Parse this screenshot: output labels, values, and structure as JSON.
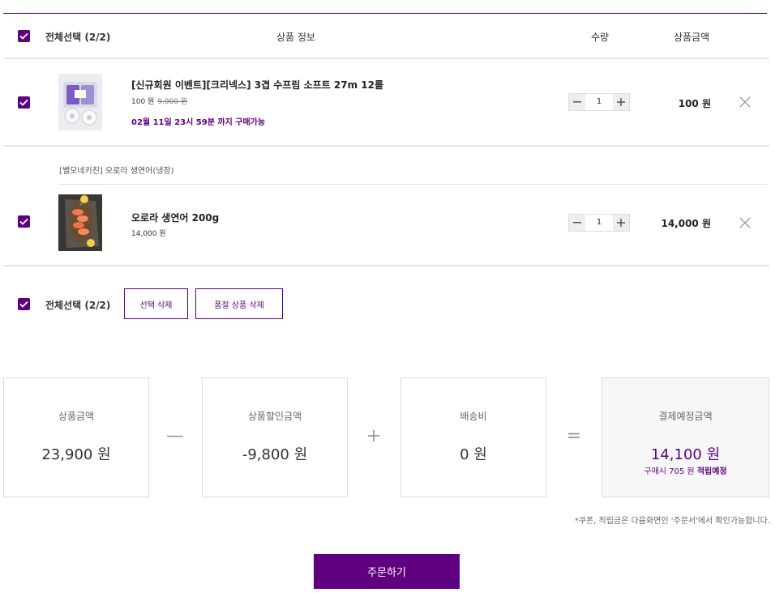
{
  "header": {
    "select_all_label": "전체선택 (2/2)",
    "product_info_label": "상품 정보",
    "quantity_label": "수량",
    "price_label": "상품금액"
  },
  "items": [
    {
      "name": "[신규회원 이벤트][크리넥스] 3겹 수프림 소프트 27m 12롤",
      "price": "100 원",
      "original_price": "9,900 원",
      "deadline": "02월 11일 23시 59분 까지 구매가능",
      "quantity": "1",
      "total": "100 원",
      "checked": true,
      "thumb_icon": "toilet-paper-pack"
    },
    {
      "vendor": "[쌜모네키친] 오로라 생연어(냉장)",
      "name": "오로라 생연어 200g",
      "price": "14,000 원",
      "quantity": "1",
      "total": "14,000 원",
      "checked": true,
      "thumb_icon": "salmon-platter"
    }
  ],
  "footer_select": {
    "select_all_label": "전체선택 (2/2)",
    "delete_selected": "선택 삭제",
    "delete_soldout": "품절 상품 삭제"
  },
  "summary": {
    "product_amount_label": "상품금액",
    "product_amount": "23,900 원",
    "discount_label": "상품할인금액",
    "discount": "-9,800 원",
    "shipping_label": "배송비",
    "shipping": "0 원",
    "total_label": "결제예정금액",
    "total": "14,100 원",
    "points_prefix": "구매시 705 원",
    "points_suffix": "적립예정",
    "op_minus": "—",
    "op_plus": "+",
    "op_equals": "="
  },
  "notice": "*쿠폰, 적립금은 다음화면인 '주문서'에서 확인가능합니다.",
  "order_button": "주문하기",
  "colors": {
    "accent": "#5f0080",
    "border": "#dddddd",
    "total_bg": "#f7f7f7"
  }
}
